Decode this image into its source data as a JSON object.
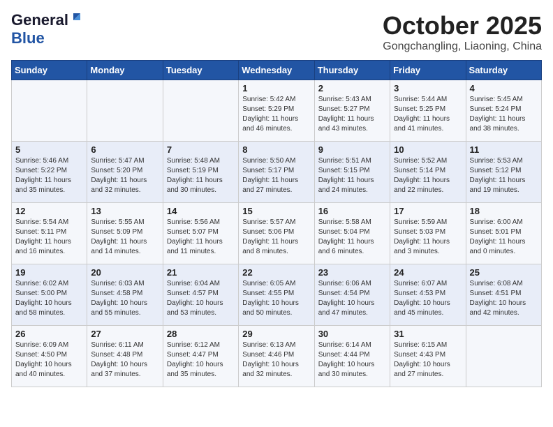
{
  "header": {
    "logo_general": "General",
    "logo_blue": "Blue",
    "month": "October 2025",
    "location": "Gongchangling, Liaoning, China"
  },
  "days_of_week": [
    "Sunday",
    "Monday",
    "Tuesday",
    "Wednesday",
    "Thursday",
    "Friday",
    "Saturday"
  ],
  "weeks": [
    [
      {
        "day": "",
        "info": ""
      },
      {
        "day": "",
        "info": ""
      },
      {
        "day": "",
        "info": ""
      },
      {
        "day": "1",
        "info": "Sunrise: 5:42 AM\nSunset: 5:29 PM\nDaylight: 11 hours\nand 46 minutes."
      },
      {
        "day": "2",
        "info": "Sunrise: 5:43 AM\nSunset: 5:27 PM\nDaylight: 11 hours\nand 43 minutes."
      },
      {
        "day": "3",
        "info": "Sunrise: 5:44 AM\nSunset: 5:25 PM\nDaylight: 11 hours\nand 41 minutes."
      },
      {
        "day": "4",
        "info": "Sunrise: 5:45 AM\nSunset: 5:24 PM\nDaylight: 11 hours\nand 38 minutes."
      }
    ],
    [
      {
        "day": "5",
        "info": "Sunrise: 5:46 AM\nSunset: 5:22 PM\nDaylight: 11 hours\nand 35 minutes."
      },
      {
        "day": "6",
        "info": "Sunrise: 5:47 AM\nSunset: 5:20 PM\nDaylight: 11 hours\nand 32 minutes."
      },
      {
        "day": "7",
        "info": "Sunrise: 5:48 AM\nSunset: 5:19 PM\nDaylight: 11 hours\nand 30 minutes."
      },
      {
        "day": "8",
        "info": "Sunrise: 5:50 AM\nSunset: 5:17 PM\nDaylight: 11 hours\nand 27 minutes."
      },
      {
        "day": "9",
        "info": "Sunrise: 5:51 AM\nSunset: 5:15 PM\nDaylight: 11 hours\nand 24 minutes."
      },
      {
        "day": "10",
        "info": "Sunrise: 5:52 AM\nSunset: 5:14 PM\nDaylight: 11 hours\nand 22 minutes."
      },
      {
        "day": "11",
        "info": "Sunrise: 5:53 AM\nSunset: 5:12 PM\nDaylight: 11 hours\nand 19 minutes."
      }
    ],
    [
      {
        "day": "12",
        "info": "Sunrise: 5:54 AM\nSunset: 5:11 PM\nDaylight: 11 hours\nand 16 minutes."
      },
      {
        "day": "13",
        "info": "Sunrise: 5:55 AM\nSunset: 5:09 PM\nDaylight: 11 hours\nand 14 minutes."
      },
      {
        "day": "14",
        "info": "Sunrise: 5:56 AM\nSunset: 5:07 PM\nDaylight: 11 hours\nand 11 minutes."
      },
      {
        "day": "15",
        "info": "Sunrise: 5:57 AM\nSunset: 5:06 PM\nDaylight: 11 hours\nand 8 minutes."
      },
      {
        "day": "16",
        "info": "Sunrise: 5:58 AM\nSunset: 5:04 PM\nDaylight: 11 hours\nand 6 minutes."
      },
      {
        "day": "17",
        "info": "Sunrise: 5:59 AM\nSunset: 5:03 PM\nDaylight: 11 hours\nand 3 minutes."
      },
      {
        "day": "18",
        "info": "Sunrise: 6:00 AM\nSunset: 5:01 PM\nDaylight: 11 hours\nand 0 minutes."
      }
    ],
    [
      {
        "day": "19",
        "info": "Sunrise: 6:02 AM\nSunset: 5:00 PM\nDaylight: 10 hours\nand 58 minutes."
      },
      {
        "day": "20",
        "info": "Sunrise: 6:03 AM\nSunset: 4:58 PM\nDaylight: 10 hours\nand 55 minutes."
      },
      {
        "day": "21",
        "info": "Sunrise: 6:04 AM\nSunset: 4:57 PM\nDaylight: 10 hours\nand 53 minutes."
      },
      {
        "day": "22",
        "info": "Sunrise: 6:05 AM\nSunset: 4:55 PM\nDaylight: 10 hours\nand 50 minutes."
      },
      {
        "day": "23",
        "info": "Sunrise: 6:06 AM\nSunset: 4:54 PM\nDaylight: 10 hours\nand 47 minutes."
      },
      {
        "day": "24",
        "info": "Sunrise: 6:07 AM\nSunset: 4:53 PM\nDaylight: 10 hours\nand 45 minutes."
      },
      {
        "day": "25",
        "info": "Sunrise: 6:08 AM\nSunset: 4:51 PM\nDaylight: 10 hours\nand 42 minutes."
      }
    ],
    [
      {
        "day": "26",
        "info": "Sunrise: 6:09 AM\nSunset: 4:50 PM\nDaylight: 10 hours\nand 40 minutes."
      },
      {
        "day": "27",
        "info": "Sunrise: 6:11 AM\nSunset: 4:48 PM\nDaylight: 10 hours\nand 37 minutes."
      },
      {
        "day": "28",
        "info": "Sunrise: 6:12 AM\nSunset: 4:47 PM\nDaylight: 10 hours\nand 35 minutes."
      },
      {
        "day": "29",
        "info": "Sunrise: 6:13 AM\nSunset: 4:46 PM\nDaylight: 10 hours\nand 32 minutes."
      },
      {
        "day": "30",
        "info": "Sunrise: 6:14 AM\nSunset: 4:44 PM\nDaylight: 10 hours\nand 30 minutes."
      },
      {
        "day": "31",
        "info": "Sunrise: 6:15 AM\nSunset: 4:43 PM\nDaylight: 10 hours\nand 27 minutes."
      },
      {
        "day": "",
        "info": ""
      }
    ]
  ]
}
